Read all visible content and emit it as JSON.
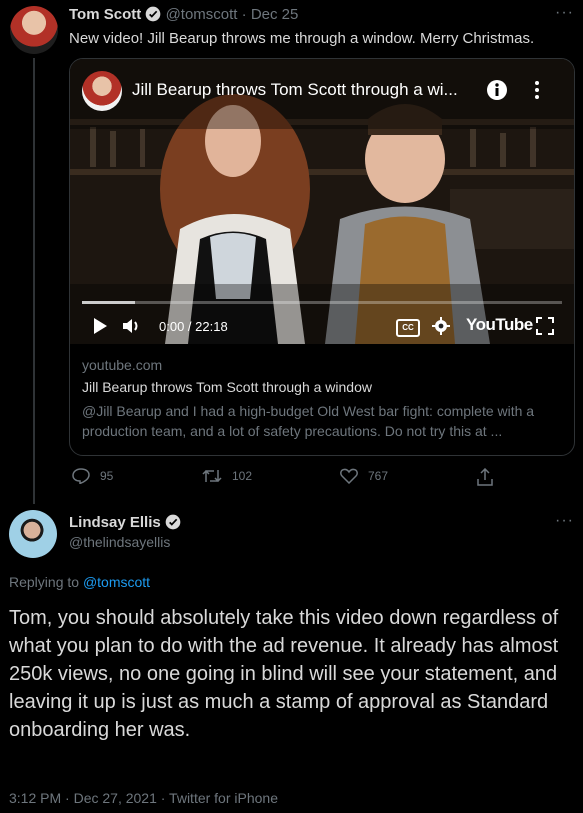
{
  "tweet1": {
    "author_name": "Tom Scott",
    "handle": "@tomscott",
    "separator": "·",
    "date": "Dec 25",
    "text": "New video! Jill Bearup throws me through a window. Merry Christmas.",
    "more": "···",
    "video": {
      "title": "Jill Bearup throws Tom Scott through a wi...",
      "time": "0:00 / 22:18",
      "brand": "YouTube",
      "cc": "CC",
      "progress_fraction": 0.11
    },
    "card": {
      "domain": "youtube.com",
      "title": "Jill Bearup throws Tom Scott through a window",
      "description": "@Jill Bearup and I had a high-budget Old West bar fight: complete with a production team, and a lot of safety precautions. Do not try this at ..."
    },
    "actions": {
      "replies": "95",
      "retweets": "102",
      "likes": "767"
    }
  },
  "tweet2": {
    "author_name": "Lindsay Ellis",
    "handle": "@thelindsayellis",
    "more": "···",
    "replying_prefix": "Replying to",
    "replying_to": "@tomscott",
    "text": "Tom, you should absolutely take this video down regardless of what you plan to do with the ad revenue. It already has almost 250k views, no one going in blind will see your statement, and leaving it up is just as much a stamp of approval as Standard onboarding her was.",
    "meta": "3:12 PM · Dec 27, 2021 · Twitter for iPhone"
  },
  "colors": {
    "accent": "#1d9bf0",
    "background": "#000000",
    "text": "#d9d9d9",
    "muted": "#6e767d"
  }
}
